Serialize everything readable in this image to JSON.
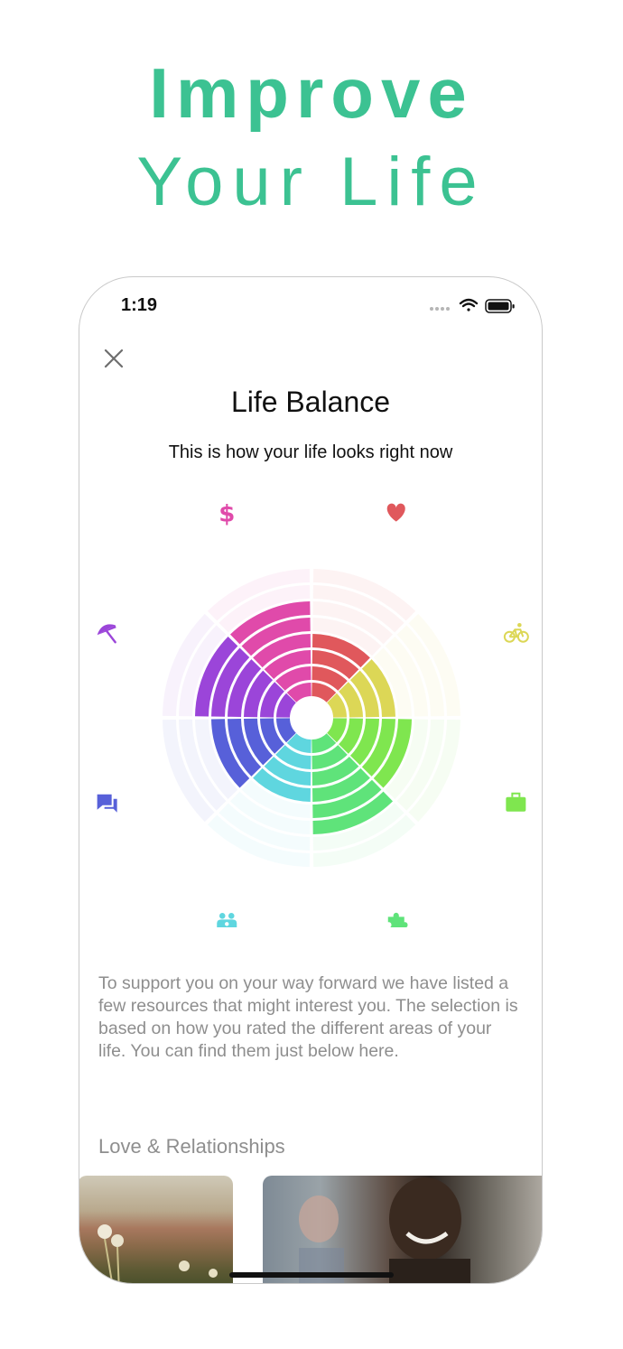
{
  "headline": {
    "line1": "Improve",
    "line2": "Your Life"
  },
  "status_bar": {
    "time": "1:19"
  },
  "screen": {
    "title": "Life Balance",
    "subtitle": "This is how your life looks right now",
    "body": "To support you on your way forward we have listed a few resources that might interest you. The selection is based on how you rated the different areas of your life. You can find them just below here.",
    "section_title": "Love & Relationships"
  },
  "wheel_segments": [
    {
      "icon": "heart-icon",
      "color": "#e0585c",
      "level": 4
    },
    {
      "icon": "bicycle-icon",
      "color": "#dcd756",
      "level": 4
    },
    {
      "icon": "briefcase-icon",
      "color": "#7fe64f",
      "level": 5
    },
    {
      "icon": "puzzle-icon",
      "color": "#5fe37a",
      "level": 6
    },
    {
      "icon": "family-icon",
      "color": "#5fd6df",
      "level": 4
    },
    {
      "icon": "chat-icon",
      "color": "#5760d9",
      "level": 5
    },
    {
      "icon": "umbrella-icon",
      "color": "#9b45d9",
      "level": 6
    },
    {
      "icon": "dollar-icon",
      "color": "#e04aaa",
      "level": 6
    }
  ],
  "wheel_max_level": 8,
  "colors": {
    "accent": "#3cc292",
    "muted_text": "#8e8e8e"
  }
}
